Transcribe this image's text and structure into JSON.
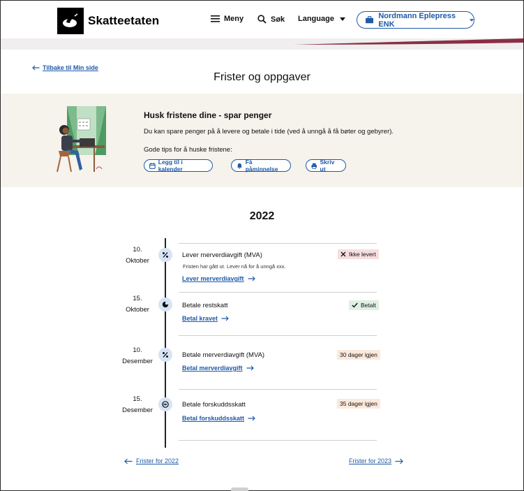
{
  "header": {
    "logo_text": "Skatteetaten",
    "menu_label": "Meny",
    "search_label": "Søk",
    "language_label": "Language",
    "account_label": "Nordmann Eplepress ENK"
  },
  "back_link": "Tilbake til Min side",
  "page_title": "Frister og oppgaver",
  "tips": {
    "title": "Husk fristene dine - spar penger",
    "text": "Du kan spare penger på å levere og betale i tide (ved å unngå å få bøter og gebyrer).",
    "subtitle": "Gode tips for å huske fristene:",
    "buttons": [
      "Legg til i kalender",
      "Få påminnelse",
      "Skriv ut"
    ]
  },
  "year": "2022",
  "deadlines": [
    {
      "day": "10.",
      "month": "Oktober",
      "icon": "percent-icon",
      "title": "Lever merverdiavgift (MVA)",
      "description": "Fristen har gått ut. Lever nå for å unngå xxx.",
      "link": "Lever merverdiavgift",
      "status": "Ikke levert"
    },
    {
      "day": "15.",
      "month": "Oktober",
      "icon": "pie-chart-icon",
      "title": "Betale restskatt",
      "description": "",
      "link": "Betal kravet",
      "status": "Betalt"
    },
    {
      "day": "10.",
      "month": "Desember",
      "icon": "percent-icon",
      "title": "Betale merverdiavgift (MVA)",
      "description": "",
      "link": "Betal merverdiavgift",
      "status": "30 dager igjen"
    },
    {
      "day": "15.",
      "month": "Desember",
      "icon": "forward-icon",
      "title": "Betale forskuddsskatt",
      "description": "",
      "link": "Betal forskuddsskatt",
      "status": "35 dager igjen"
    }
  ],
  "footer": {
    "prev_label": "Frister for 2022",
    "next_label": "Frister for 2023"
  },
  "colors": {
    "brand_blue": "#1e5aa8",
    "tips_bg": "#f6f2ec",
    "icon_bg": "#d7e4f5",
    "badge_red": "#f7dede",
    "badge_green": "#dff0e2",
    "badge_peach": "#fbe9dc",
    "accent_wine": "#8a2f45"
  }
}
